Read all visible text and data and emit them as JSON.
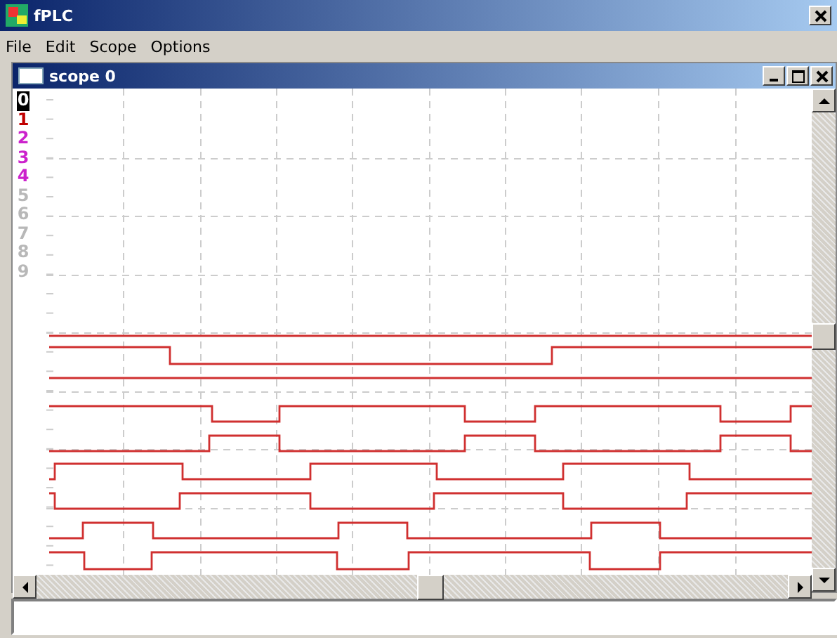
{
  "window": {
    "title": "fPLC"
  },
  "menu": [
    "File",
    "Edit",
    "Scope",
    "Options"
  ],
  "scope_window": {
    "title": "scope 0"
  },
  "channels": [
    {
      "label": "0",
      "color": "#000000",
      "selected": true
    },
    {
      "label": "1",
      "color": "#c00000",
      "selected": false
    },
    {
      "label": "2",
      "color": "#cc22cc",
      "selected": false
    },
    {
      "label": "3",
      "color": "#cc22cc",
      "selected": false
    },
    {
      "label": "4",
      "color": "#cc22cc",
      "selected": false
    },
    {
      "label": "5",
      "color": "#b8b8b8",
      "selected": false
    },
    {
      "label": "6",
      "color": "#b8b8b8",
      "selected": false
    },
    {
      "label": "7",
      "color": "#b8b8b8",
      "selected": false
    },
    {
      "label": "8",
      "color": "#b8b8b8",
      "selected": false
    },
    {
      "label": "9",
      "color": "#b8b8b8",
      "selected": false
    }
  ]
}
